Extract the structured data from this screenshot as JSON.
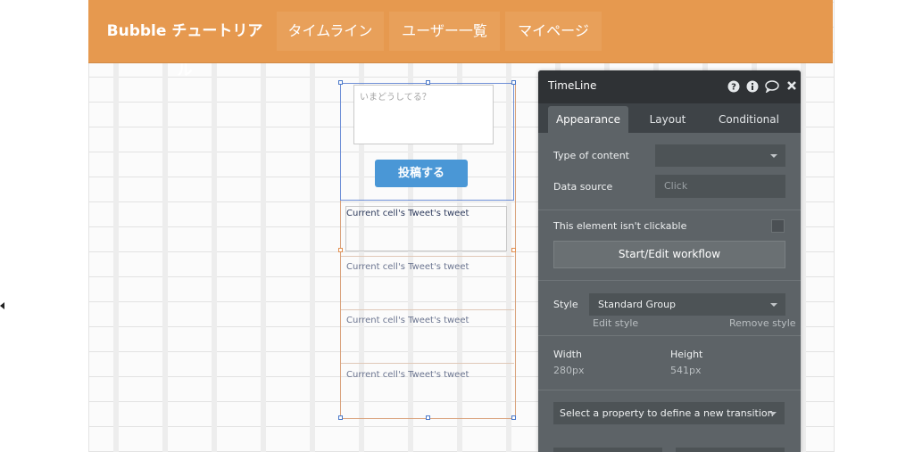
{
  "nav": {
    "brand": "Bubble チュートリアル",
    "items": [
      "タイムライン",
      "ユーザー一覧",
      "マイページ"
    ]
  },
  "canvas": {
    "textarea_placeholder": "いまどうしてる？",
    "post_button": "投稿する",
    "cells": [
      "Current cell's Tweet's tweet",
      "Current cell's Tweet's tweet",
      "Current cell's Tweet's tweet",
      "Current cell's Tweet's tweet"
    ]
  },
  "panel": {
    "title": "TimeLine",
    "icons": [
      "help-icon",
      "info-icon",
      "comment-icon",
      "close-icon"
    ],
    "tabs": [
      "Appearance",
      "Layout",
      "Conditional"
    ],
    "active_tab": "Appearance",
    "type_of_content_label": "Type of content",
    "type_of_content_value": "",
    "data_source_label": "Data source",
    "data_source_value": "Click",
    "not_clickable_label": "This element isn't clickable",
    "not_clickable_checked": false,
    "workflow_button": "Start/Edit workflow",
    "style_label": "Style",
    "style_value": "Standard Group",
    "edit_style": "Edit style",
    "remove_style": "Remove style",
    "width_label": "Width",
    "width_value": "280px",
    "height_label": "Height",
    "height_value": "541px",
    "transition_select": "Select a property to define a new transition"
  },
  "colors": {
    "header": "#e6994f",
    "button": "#4a97d6",
    "panel": "#5d6367",
    "panel_header": "#2f3235"
  }
}
